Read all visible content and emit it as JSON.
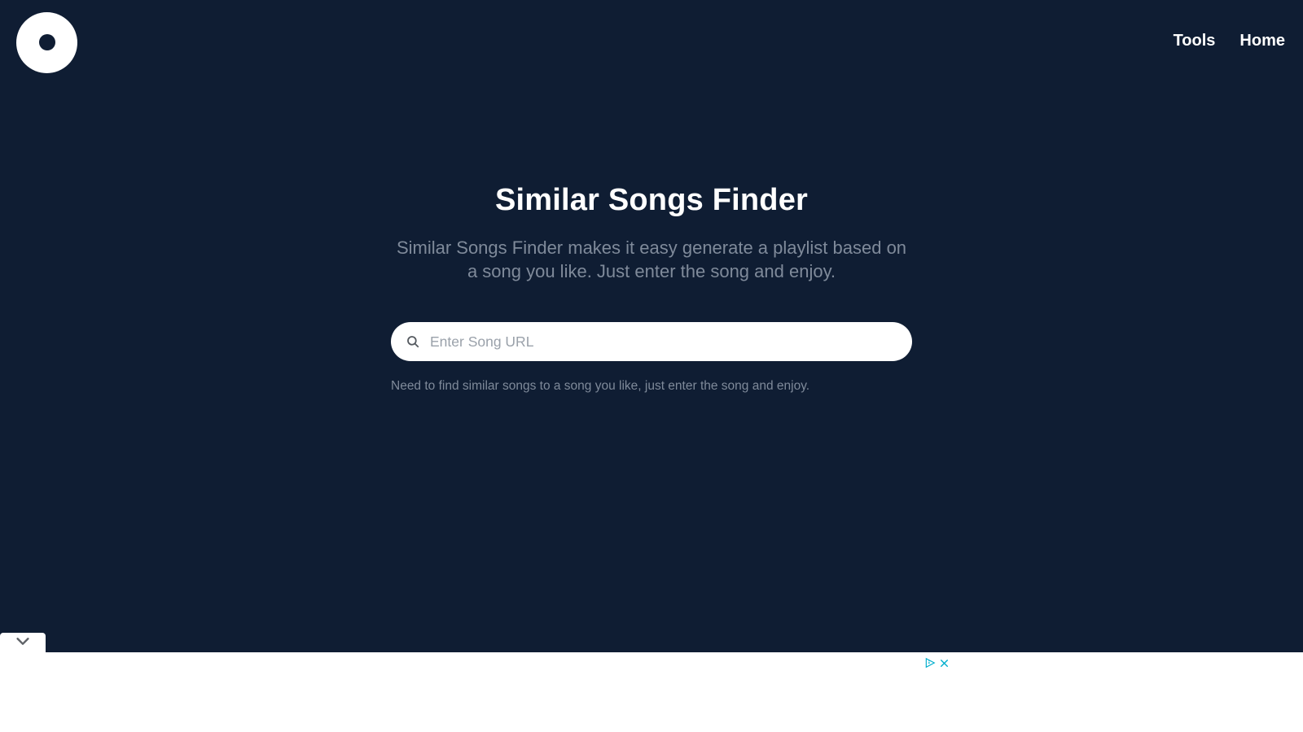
{
  "nav": {
    "tools": "Tools",
    "home": "Home"
  },
  "hero": {
    "title": "Similar Songs Finder",
    "subtitle": "Similar Songs Finder makes it easy generate a playlist based on a song you like. Just enter the song and enjoy."
  },
  "search": {
    "placeholder": "Enter Song URL",
    "value": ""
  },
  "hint": "Need to find similar songs to a song you like, just enter the song and enjoy."
}
